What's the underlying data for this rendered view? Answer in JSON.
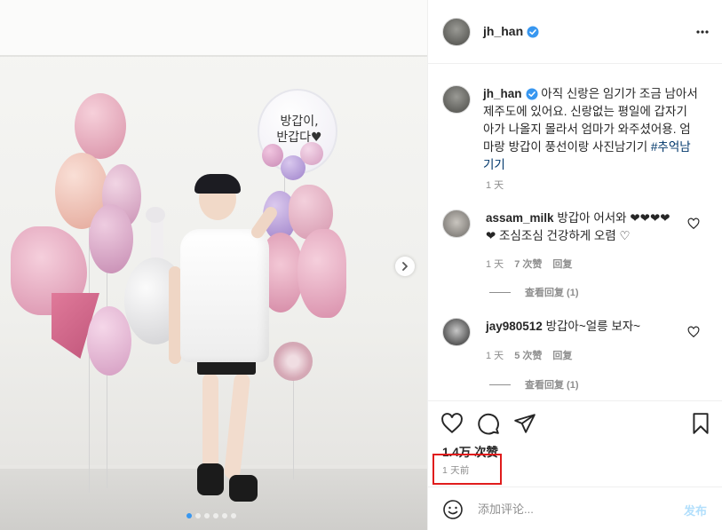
{
  "post": {
    "username": "jh_han",
    "caption_username": "jh_han",
    "caption_text": "아직 신랑은 임기가 조금 남아서 제주도에 있어요. 신랑없는 평일에 갑자기 아가 나올지 몰라서 엄마가 와주셨어용. 엄마랑 방갑이 풍선이랑 사진남기기 ",
    "hashtag": "#추억남기기",
    "caption_time": "1 天",
    "balloon_text_line1": "방갑이,",
    "balloon_text_line2": "반갑다♥"
  },
  "comments": [
    {
      "username": "assam_milk",
      "text": "방갑아 어서와 ❤❤❤❤❤ 조심조심 건강하게 오렴 ♡",
      "time": "1 天",
      "likes": "7 次赞",
      "reply": "回复",
      "view_replies": "查看回复 (1)"
    },
    {
      "username": "jay980512",
      "text": "방갑아~얼릉 보자~",
      "time": "1 天",
      "likes": "5 次赞",
      "reply": "回复",
      "view_replies": "查看回复 (1)"
    }
  ],
  "stats": {
    "likes": "1.4万 次赞",
    "posted": "1 天前"
  },
  "add_comment": {
    "placeholder": "添加评论...",
    "post_label": "发布"
  },
  "carousel": {
    "total": 6,
    "active_index": 0
  },
  "colors": {
    "highlight": "#e01c1c",
    "link": "#00376b",
    "verified": "#3897f0",
    "muted": "#8e8e8e"
  }
}
